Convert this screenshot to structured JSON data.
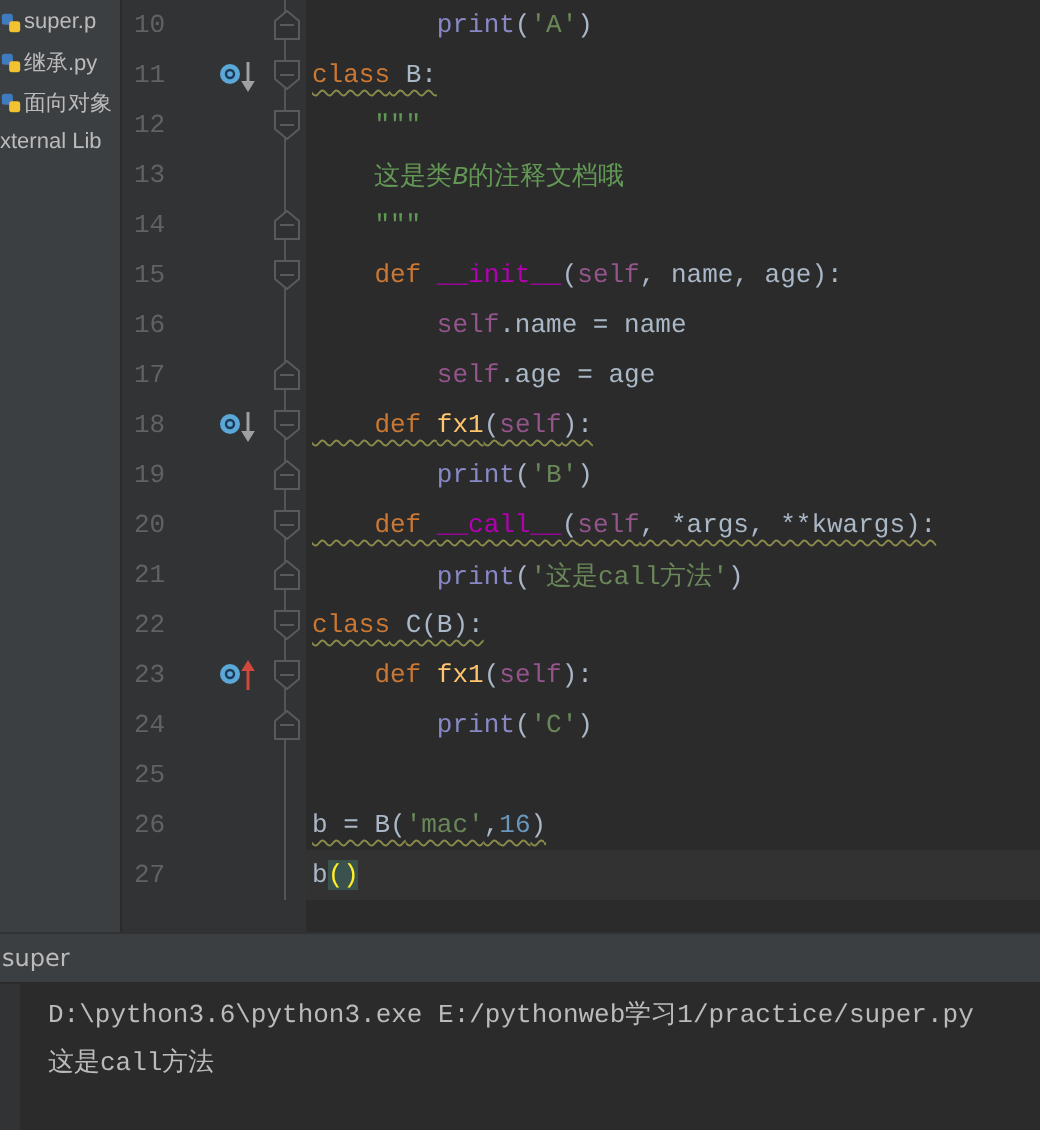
{
  "project_tree": {
    "items": [
      {
        "label": "super.p",
        "kind": "py"
      },
      {
        "label": "继承.py",
        "kind": "py"
      },
      {
        "label": "面向对象",
        "kind": "py"
      },
      {
        "label": "xternal Lib",
        "kind": "lib"
      }
    ]
  },
  "editor": {
    "lines": [
      {
        "number": "10",
        "fold": {
          "kind": "end"
        },
        "tokens": [
          {
            "t": "        print",
            "kind": "builtin"
          },
          {
            "t": "(",
            "kind": "plain"
          },
          {
            "t": "'A'",
            "kind": "string"
          },
          {
            "t": ")",
            "kind": "plain"
          }
        ]
      },
      {
        "number": "11",
        "fold": {
          "kind": "start"
        },
        "marker": {
          "kind": "down"
        },
        "warn": true,
        "tokens": [
          {
            "t": "class",
            "kind": "keyword"
          },
          {
            "t": " B:",
            "kind": "plain"
          }
        ]
      },
      {
        "number": "12",
        "fold": {
          "kind": "start"
        },
        "tokens": [
          {
            "t": "    \"\"\"",
            "kind": "doc"
          }
        ]
      },
      {
        "number": "13",
        "tokens": [
          {
            "t": "    这是类",
            "kind": "doc"
          },
          {
            "t": "B",
            "kind": "doc-italic"
          },
          {
            "t": "的注释文档哦",
            "kind": "doc"
          }
        ]
      },
      {
        "number": "14",
        "fold": {
          "kind": "end"
        },
        "tokens": [
          {
            "t": "    \"\"\"",
            "kind": "doc"
          }
        ]
      },
      {
        "number": "15",
        "fold": {
          "kind": "start"
        },
        "tokens": [
          {
            "t": "    def ",
            "kind": "keyword"
          },
          {
            "t": "__init__",
            "kind": "magic"
          },
          {
            "t": "(",
            "kind": "plain"
          },
          {
            "t": "self",
            "kind": "self"
          },
          {
            "t": ", name, age):",
            "kind": "plain"
          }
        ]
      },
      {
        "number": "16",
        "tokens": [
          {
            "t": "        self",
            "kind": "self"
          },
          {
            "t": ".name = name",
            "kind": "plain"
          }
        ]
      },
      {
        "number": "17",
        "fold": {
          "kind": "end"
        },
        "tokens": [
          {
            "t": "        self",
            "kind": "self"
          },
          {
            "t": ".age = age",
            "kind": "plain"
          }
        ]
      },
      {
        "number": "18",
        "fold": {
          "kind": "start"
        },
        "marker": {
          "kind": "down"
        },
        "warn": true,
        "tokens": [
          {
            "t": "    def ",
            "kind": "keyword"
          },
          {
            "t": "fx1",
            "kind": "func"
          },
          {
            "t": "(",
            "kind": "plain"
          },
          {
            "t": "self",
            "kind": "self"
          },
          {
            "t": "):",
            "kind": "plain"
          }
        ]
      },
      {
        "number": "19",
        "fold": {
          "kind": "end"
        },
        "tokens": [
          {
            "t": "        print",
            "kind": "builtin"
          },
          {
            "t": "(",
            "kind": "plain"
          },
          {
            "t": "'B'",
            "kind": "string"
          },
          {
            "t": ")",
            "kind": "plain"
          }
        ]
      },
      {
        "number": "20",
        "fold": {
          "kind": "start"
        },
        "warn": true,
        "tokens": [
          {
            "t": "    def ",
            "kind": "keyword"
          },
          {
            "t": "__call__",
            "kind": "magic"
          },
          {
            "t": "(",
            "kind": "plain"
          },
          {
            "t": "self",
            "kind": "self"
          },
          {
            "t": ", *args, **kwargs):",
            "kind": "plain"
          }
        ]
      },
      {
        "number": "21",
        "fold": {
          "kind": "end"
        },
        "tokens": [
          {
            "t": "        print",
            "kind": "builtin"
          },
          {
            "t": "(",
            "kind": "plain"
          },
          {
            "t": "'这是call方法'",
            "kind": "string"
          },
          {
            "t": ")",
            "kind": "plain"
          }
        ]
      },
      {
        "number": "22",
        "fold": {
          "kind": "start"
        },
        "warn": true,
        "tokens": [
          {
            "t": "class",
            "kind": "keyword"
          },
          {
            "t": " C(B):",
            "kind": "plain"
          }
        ]
      },
      {
        "number": "23",
        "fold": {
          "kind": "start"
        },
        "marker": {
          "kind": "up"
        },
        "tokens": [
          {
            "t": "    def ",
            "kind": "keyword"
          },
          {
            "t": "fx1",
            "kind": "func"
          },
          {
            "t": "(",
            "kind": "plain"
          },
          {
            "t": "self",
            "kind": "self"
          },
          {
            "t": "):",
            "kind": "plain"
          }
        ]
      },
      {
        "number": "24",
        "fold": {
          "kind": "end"
        },
        "tokens": [
          {
            "t": "        print",
            "kind": "builtin"
          },
          {
            "t": "(",
            "kind": "plain"
          },
          {
            "t": "'C'",
            "kind": "string"
          },
          {
            "t": ")",
            "kind": "plain"
          }
        ]
      },
      {
        "number": "25"
      },
      {
        "number": "26",
        "warn": true,
        "tokens": [
          {
            "t": "b = B(",
            "kind": "plain"
          },
          {
            "t": "'mac'",
            "kind": "string"
          },
          {
            "t": ",",
            "kind": "plain"
          },
          {
            "t": "16",
            "kind": "number"
          },
          {
            "t": ")",
            "kind": "plain"
          }
        ]
      },
      {
        "number": "27",
        "current": true,
        "tokens": [
          {
            "t": "b",
            "kind": "plain"
          },
          {
            "t": "()",
            "kind": "brace-match"
          }
        ]
      }
    ]
  },
  "run_panel": {
    "title": "super",
    "output": [
      "D:\\python3.6\\python3.exe E:/pythonweb学习1/practice/super.py",
      "这是call方法"
    ]
  }
}
